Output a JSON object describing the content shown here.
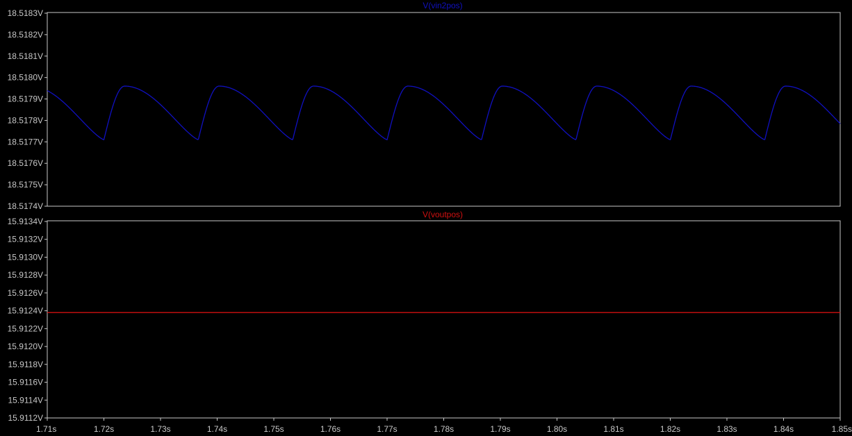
{
  "chart_data": [
    {
      "type": "line",
      "title": "V(vin2pos)",
      "unit": "V",
      "ylim": [
        18.5174,
        18.5183
      ],
      "yticks": [
        "18.5183V",
        "18.5182V",
        "18.5181V",
        "18.5180V",
        "18.5179V",
        "18.5178V",
        "18.5177V",
        "18.5176V",
        "18.5175V",
        "18.5174V"
      ],
      "xlim": [
        1.71,
        1.85
      ],
      "series": [
        {
          "name": "V(vin2pos)",
          "color": "#1010c0",
          "waveform": {
            "kind": "full-wave-rectified ripple",
            "ripple_period": 0.01667,
            "peak": 18.51796,
            "trough": 18.51771,
            "troughs_at": [
              1.72,
              1.7367,
              1.7533,
              1.77,
              1.7867,
              1.8033,
              1.82,
              1.8367
            ]
          }
        }
      ]
    },
    {
      "type": "line",
      "title": "V(voutpos)",
      "unit": "V",
      "ylim": [
        15.9112,
        15.9134
      ],
      "yticks": [
        "15.9134V",
        "15.9132V",
        "15.9130V",
        "15.9128V",
        "15.9126V",
        "15.9124V",
        "15.9122V",
        "15.9120V",
        "15.9118V",
        "15.9116V",
        "15.9114V",
        "15.9112V"
      ],
      "xlim": [
        1.71,
        1.85
      ],
      "xticks": [
        "1.71s",
        "1.72s",
        "1.73s",
        "1.74s",
        "1.75s",
        "1.76s",
        "1.77s",
        "1.78s",
        "1.79s",
        "1.80s",
        "1.81s",
        "1.82s",
        "1.83s",
        "1.84s",
        "1.85s"
      ],
      "series": [
        {
          "name": "V(voutpos)",
          "color": "#d01010",
          "x": [
            1.71,
            1.85
          ],
          "values": [
            15.91238,
            15.91238
          ]
        }
      ]
    }
  ],
  "colors": {
    "background": "#000000",
    "frame": "#c8c8c8",
    "axis_text": "#c8c8c8"
  }
}
